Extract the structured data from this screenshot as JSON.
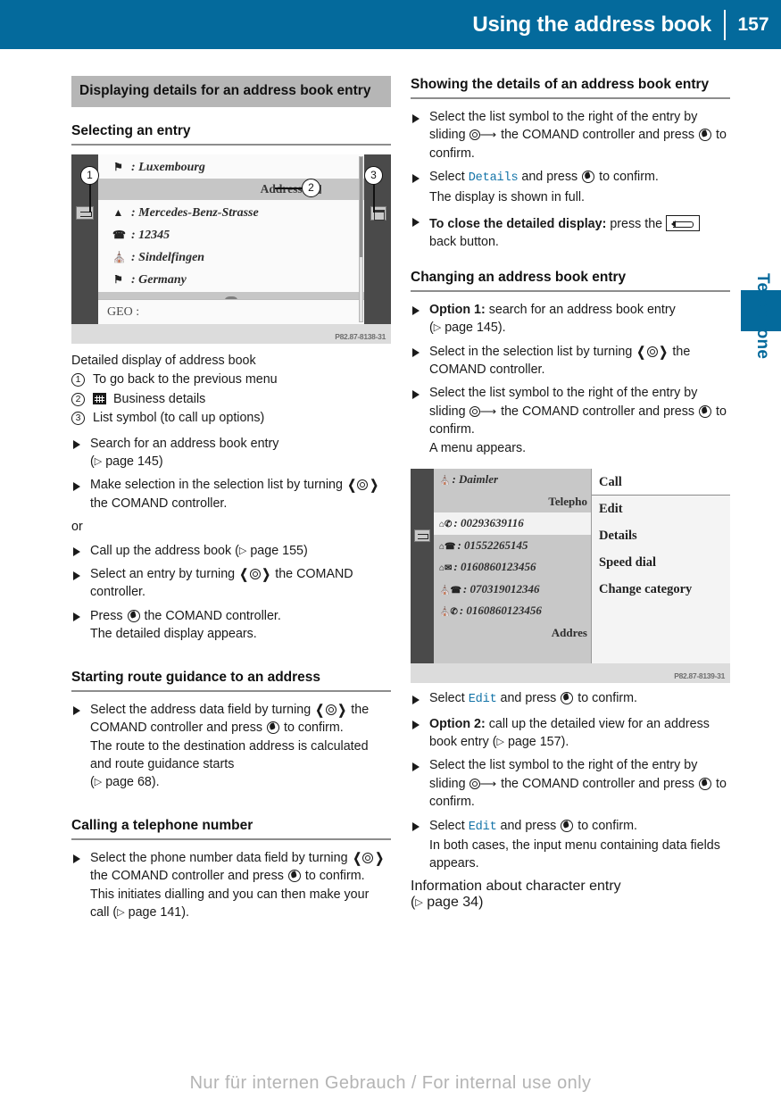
{
  "header": {
    "title": "Using the address book",
    "page_number": "157",
    "bar_color": "#046a9c"
  },
  "side_tab": {
    "label": "Telephone",
    "color": "#046a9c"
  },
  "left_column": {
    "gray_heading": "Displaying details for an address book entry",
    "section1_heading": "Selecting an entry",
    "figure1": {
      "id_code": "P82.87-8138-31",
      "rows": [
        {
          "icon": "flag-icon",
          "text": ": Luxembourg"
        },
        {
          "icon": "street-icon",
          "text": ": Mercedes-Benz-Strasse"
        },
        {
          "icon": "phone-icon",
          "text": ": 12345"
        },
        {
          "icon": "city-icon",
          "text": ": Sindelfingen"
        },
        {
          "icon": "flag-icon",
          "text": ": Germany"
        }
      ],
      "band_label": "Address",
      "geo_label": "GEO :",
      "callouts": [
        "1",
        "2",
        "3"
      ]
    },
    "figure1_caption": "Detailed display of address book",
    "legend": [
      {
        "num": "1",
        "text": "To go back to the previous menu",
        "icon": ""
      },
      {
        "num": "2",
        "text": "Business details",
        "icon": "building-icon"
      },
      {
        "num": "3",
        "text": "List symbol (to call up options)",
        "icon": ""
      }
    ],
    "steps_select": [
      {
        "lead": "",
        "text": "Search for an address book entry (▷ page 145)"
      },
      {
        "lead": "",
        "text": "Make selection in the selection list by turning [turn] the COMAND controller."
      }
    ],
    "or_label": "or",
    "steps_select2": [
      {
        "text": "Call up the address book (▷ page 155)"
      },
      {
        "text": "Select an entry by turning [turn] the COMAND controller."
      },
      {
        "text": "Press [press] the COMAND controller.",
        "sub": "The detailed display appears."
      }
    ],
    "section2_heading": "Starting route guidance to an address",
    "section2_step": {
      "main": "Select the address data field by turning [turn] the COMAND controller and press [press] to confirm.",
      "sub": "The route to the destination address is calculated and route guidance starts (▷ page 68)."
    },
    "section3_heading": "Calling a telephone number",
    "section3_step": {
      "main": "Select the phone number data field by turning [turn] the COMAND controller and press [press] to confirm.",
      "sub": "This initiates dialling and you can then make your call (▷ page 141)."
    }
  },
  "right_column": {
    "section1_heading": "Showing the details of an address book entry",
    "steps1": [
      {
        "text": "Select the list symbol to the right of the entry by sliding [slide] the COMAND controller and press [press] to confirm."
      },
      {
        "text": "Select Details and press [press] to confirm.",
        "code": "Details",
        "sub": "The display is shown in full."
      },
      {
        "bold": "To close the detailed display:",
        "text": "press the [back] back button."
      }
    ],
    "section2_heading": "Changing an address book entry",
    "steps2": [
      {
        "bold": "Option 1:",
        "text": "search for an address book entry (▷ page 145)."
      },
      {
        "text": "Select in the selection list by turning [turn] the COMAND controller."
      },
      {
        "text": "Select the list symbol to the right of the entry by sliding [slide] the COMAND controller and press [press] to confirm.",
        "sub": "A menu appears."
      }
    ],
    "figure2": {
      "id_code": "P82.87-8139-31",
      "left_rows": [
        {
          "icon": "company-icon",
          "text": ": Daimler",
          "type": "entry"
        },
        {
          "text": "Telepho",
          "type": "band"
        },
        {
          "icon": "home-mobile-icon",
          "text": ": 00293639116",
          "type": "entry",
          "highlight": true
        },
        {
          "icon": "home-phone-icon",
          "text": ": 01552265145",
          "type": "entry"
        },
        {
          "icon": "home-fax-icon",
          "text": ": 0160860123456",
          "type": "entry"
        },
        {
          "icon": "work-phone-icon",
          "text": ": 070319012346",
          "type": "entry"
        },
        {
          "icon": "work-mobile-icon",
          "text": ": 0160860123456",
          "type": "entry"
        },
        {
          "text": "Addres",
          "type": "band"
        }
      ],
      "menu_items": [
        "Call",
        "Edit",
        "Details",
        "Speed dial",
        "Change category"
      ],
      "selected_menu_item": "Call"
    },
    "steps3": [
      {
        "text": "Select Edit and press [press] to confirm.",
        "code": "Edit"
      },
      {
        "bold": "Option 2:",
        "text": "call up the detailed view for an address book entry (▷ page 157)."
      },
      {
        "text": "Select the list symbol to the right of the entry by sliding [slide] the COMAND controller and press [press] to confirm."
      },
      {
        "text": "Select Edit and press [press] to confirm.",
        "code": "Edit",
        "sub": "In both cases, the input menu containing data fields appears."
      }
    ],
    "closing_note": "Information about character entry (▷ page 34)"
  },
  "watermark": "Nur für internen Gebrauch / For internal use only"
}
